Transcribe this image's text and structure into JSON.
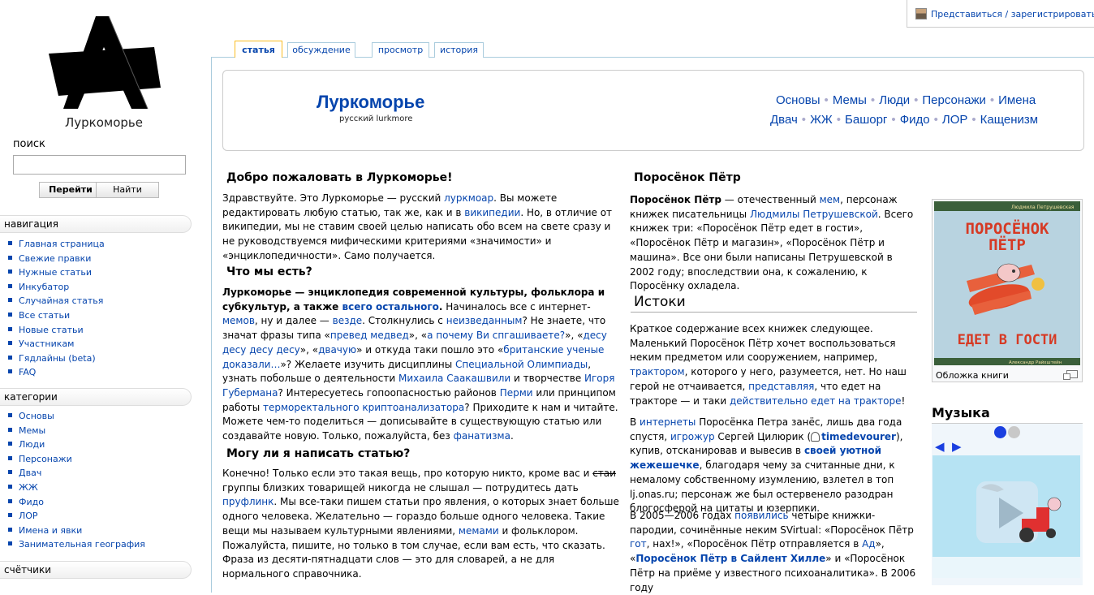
{
  "personal": {
    "login": "Представиться / зарегистрироваться"
  },
  "logo": {
    "title": "Луркоморье"
  },
  "search": {
    "label": "поиск",
    "placeholder": "",
    "go": "Перейти",
    "find": "Найти"
  },
  "navigation": {
    "title": "навигация",
    "items": [
      "Главная страница",
      "Свежие правки",
      "Нужные статьи",
      "Инкубатор",
      "Случайная статья",
      "Все статьи",
      "Новые статьи",
      "Участникам",
      "Гядлайны (beta)",
      "FAQ"
    ]
  },
  "categories": {
    "title": "категории",
    "items": [
      "Основы",
      "Мемы",
      "Люди",
      "Персонажи",
      "Двач",
      "ЖЖ",
      "Фидо",
      "ЛОР",
      "Имена и явки",
      "Занимательная география"
    ]
  },
  "counters": {
    "title": "счётчики"
  },
  "tabs": [
    "статья",
    "обсуждение",
    "просмотр",
    "история"
  ],
  "header": {
    "title": "Луркоморье",
    "subtitle": "русский lurkmore",
    "row1": [
      "Основы",
      "Мемы",
      "Люди",
      "Персонажи",
      "Имена"
    ],
    "row2": [
      "Двач",
      "ЖЖ",
      "Башорг",
      "Фидо",
      "ЛОР",
      "Кащенизм"
    ]
  },
  "left": {
    "welcome_h": "Добро пожаловать в Луркоморье!",
    "welcome": {
      "t1": "Здравствуйте. Это Луркоморье — русский ",
      "l1": "луркмоар",
      "t2": ". Вы можете редактировать любую статью, так же, как и в ",
      "l2": "википедии",
      "t3": ". Но, в отличие от википедии, мы не ставим своей целью написать обо всем на свете сразу и не руководствуемся мифическими критериями «значимости» и «энциклопедичности». Само получается."
    },
    "what_h": "Что мы есть?",
    "what": {
      "b1": "Луркоморье — энциклопедия современной культуры, фольклора и субкультур, а также ",
      "l1": "всего остального",
      "b2": ".",
      "t1": " Начиналось все с интернет-",
      "l2": "мемов",
      "t2": ", ну и далее — ",
      "l3": "везде",
      "t3": ". Столкнулись с ",
      "l4": "неизведанным",
      "t4": "? Не знаете, что значат фразы типа «",
      "l5": "превед медвед",
      "t5": "», «",
      "l6": "а почему Ви спгашиваете?",
      "t6": "», «",
      "l7": "десу десу десу десу",
      "t7": "», «",
      "l8": "двачую",
      "t8": "» и откуда таки пошло это «",
      "l9": "британские ученые доказали…",
      "t9": "»? Желаете изучить дисциплины ",
      "l10": "Специальной Олимпиады",
      "t10": ", узнать побольше о деятельности ",
      "l11": "Михаила Саакашвили",
      "t11": " и творчестве ",
      "l12": "Игоря Губермана",
      "t12": "? Интересуетесь гопоопасностью районов ",
      "l13": "Перми",
      "t13": " или принципом работы ",
      "l14": "терморектального криптоанализатора",
      "t14": "? Приходите к нам и читайте. Можете чем-то поделиться — дописывайте в существующую статью или создавайте новую. Только, пожалуйста, без ",
      "l15": "фанатизма",
      "t15": "."
    },
    "can_h": "Могу ли я написать статью?",
    "can": {
      "t1": "Конечно! Только если это такая вещь, про которую никто, кроме вас и ",
      "s1": "стаи",
      "t2": " группы близких товарищей никогда не слышал — потрудитесь дать ",
      "l1": "пруфлинк",
      "t3": ". Мы все-таки пишем статьи про явления, о которых знает больше одного человека. Желательно — гораздо больше одного человека. Такие вещи мы называем культурными явлениями, ",
      "l2": "мемами",
      "t4": " и фольклором. Пожалуйста, пишите, но только в том случае, если вам есть, что сказать. Фраза из десяти-пятнадцати слов — это для словарей, а не для нормального справочника."
    }
  },
  "right": {
    "title": "Поросёнок Пётр",
    "intro": {
      "b1": "Поросёнок Пётр",
      "t1": " — отечественный ",
      "l1": "мем",
      "t2": ", персонаж книжек писательницы ",
      "l2": "Людмилы Петрушевской",
      "t3": ". Всего книжек три: «Поросёнок Пётр едет в гости», «Поросёнок Пётр и магазин», «Поросёнок Пётр и машина». Все они были написаны Петрушевской в 2002 году; впоследствии она, к сожалению, к Поросёнку охладела."
    },
    "istoki_h": "Истоки",
    "p1": {
      "t1": "Краткое содержание всех книжек следующее. Маленький Поросёнок Пётр хочет воспользоваться неким предметом или сооружением, например, ",
      "l1": "трактором",
      "t2": ", которого у него, разумеется, нет. Но наш герой не отчаивается, ",
      "l2": "представляя",
      "t3": ", что едет на тракторе — и таки ",
      "l3": "действительно едет на тракторе",
      "t4": "!"
    },
    "p2": {
      "t1": "В ",
      "l1": "интернеты",
      "t2": " Поросёнка Петра занёс, лишь два года спустя, ",
      "l2": "игрожур",
      "t3": " Сергей Цилюрик (",
      "l3": "timedevourer",
      "t4": "), купив, отсканировав и вывесив в ",
      "l4": "своей уютной жежешечке",
      "t5": ", благодаря чему за считанные дни, к немалому собственному изумлению, взлетел в топ lj.onas.ru; персонаж же был остервенело разодран блогосферой на цитаты и юзерпики."
    },
    "p3": {
      "t1": "В 2005—2006 годах ",
      "l1": "появились",
      "t2": " четыре книжки-пародии, сочинённые неким SVirtual: «Поросёнок Пётр ",
      "l2": "гот",
      "t3": ", нах!», «Поросёнок Пётр отправляется в ",
      "l3": "Ад",
      "t4": "», «",
      "l4": "Поросёнок Пётр в Сайлент Хилле",
      "t5": "» и «Поросёнок Пётр на приёме у известного психоаналитика». В 2006 году"
    },
    "book": {
      "cover_line1": "ПОРОСЁНОК",
      "cover_line2": "ПЁТР",
      "cover_line3": "ЕДЕТ В ГОСТИ",
      "cover_author": "Людмила Петрушевская",
      "cover_artist": "Александр Райхштейн",
      "caption": "Обложка книги"
    },
    "music_h": "Музыка"
  },
  "colors": {
    "link": "#0645ad",
    "tab_active": "#fabd23",
    "cover_bg": "#b8d3e0",
    "cover_text": "#d63a24",
    "dot_active": "#1a3fe0"
  }
}
